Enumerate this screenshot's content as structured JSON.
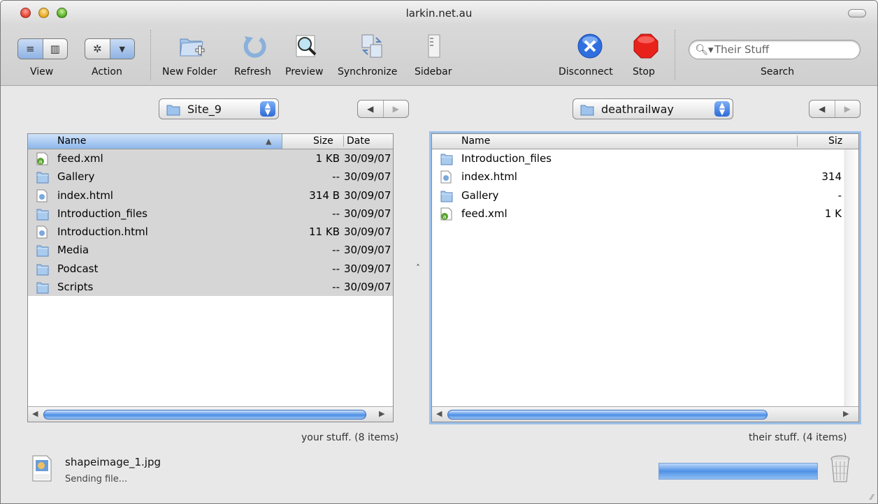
{
  "window": {
    "title": "larkin.net.au"
  },
  "toolbar": {
    "view_label": "View",
    "action_label": "Action",
    "new_folder_label": "New Folder",
    "refresh_label": "Refresh",
    "preview_label": "Preview",
    "synchronize_label": "Synchronize",
    "sidebar_label": "Sidebar",
    "disconnect_label": "Disconnect",
    "stop_label": "Stop",
    "search_label": "Search",
    "search_placeholder": "Their Stuff"
  },
  "local": {
    "folder": "Site_9",
    "columns": {
      "name": "Name",
      "size": "Size",
      "date": "Date"
    },
    "files": [
      {
        "name": "feed.xml",
        "size": "1 KB",
        "date": "30/09/07",
        "icon": "xml-feed-icon"
      },
      {
        "name": "Gallery",
        "size": "--",
        "date": "30/09/07",
        "icon": "folder-icon"
      },
      {
        "name": "index.html",
        "size": "314 B",
        "date": "30/09/07",
        "icon": "html-file-icon"
      },
      {
        "name": "Introduction_files",
        "size": "--",
        "date": "30/09/07",
        "icon": "folder-icon"
      },
      {
        "name": "Introduction.html",
        "size": "11 KB",
        "date": "30/09/07",
        "icon": "html-file-icon"
      },
      {
        "name": "Media",
        "size": "--",
        "date": "30/09/07",
        "icon": "folder-icon"
      },
      {
        "name": "Podcast",
        "size": "--",
        "date": "30/09/07",
        "icon": "folder-icon"
      },
      {
        "name": "Scripts",
        "size": "--",
        "date": "30/09/07",
        "icon": "folder-icon"
      }
    ],
    "count_text": "your stuff. (8 items)"
  },
  "remote": {
    "folder": "deathrailway",
    "columns": {
      "name": "Name",
      "size": "Siz"
    },
    "files": [
      {
        "name": "Introduction_files",
        "size": "",
        "icon": "folder-icon"
      },
      {
        "name": "index.html",
        "size": "314",
        "icon": "html-file-icon"
      },
      {
        "name": "Gallery",
        "size": "-",
        "icon": "folder-icon"
      },
      {
        "name": "feed.xml",
        "size": "1 K",
        "icon": "xml-feed-icon"
      }
    ],
    "count_text": "their stuff. (4 items)"
  },
  "transfer": {
    "file_name": "shapeimage_1.jpg",
    "status": "Sending file...",
    "progress": 1.0
  },
  "colors": {
    "accent": "#4f90e6",
    "selection": "#d6d6d6",
    "stop": "#e8221b",
    "disconnect": "#2f6fe0"
  }
}
